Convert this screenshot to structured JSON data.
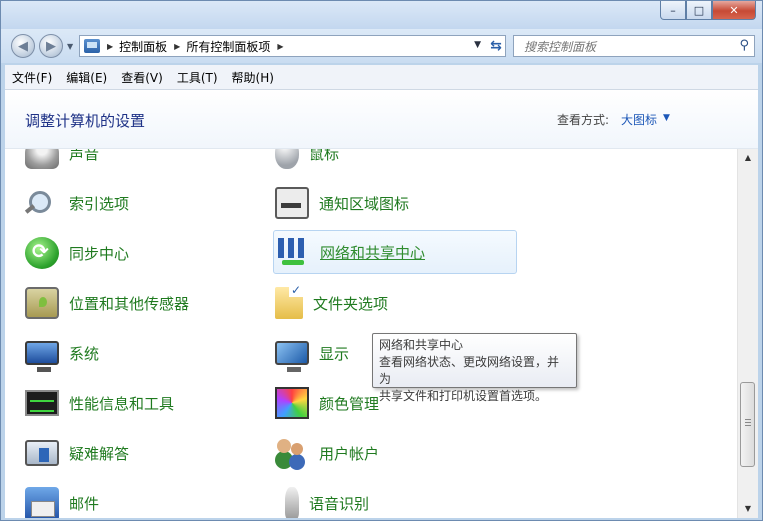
{
  "window": {
    "caption_buttons": {
      "minimize": "–",
      "maximize": "□",
      "close": "✕"
    }
  },
  "nav": {
    "back_icon": "back-arrow-icon",
    "forward_icon": "forward-arrow-icon",
    "breadcrumbs": [
      "控制面板",
      "所有控制面板项"
    ],
    "search_placeholder": "搜索控制面板"
  },
  "menu": [
    "文件(F)",
    "编辑(E)",
    "查看(V)",
    "工具(T)",
    "帮助(H)"
  ],
  "header": {
    "title": "调整计算机的设置",
    "view_label": "查看方式:",
    "view_value": "大图标"
  },
  "items": [
    {
      "label": "声音",
      "icon": "speaker-icon"
    },
    {
      "label": "鼠标",
      "icon": "mouse-icon"
    },
    {
      "label": "索引选项",
      "icon": "magnifier-icon"
    },
    {
      "label": "通知区域图标",
      "icon": "notification-tray-icon"
    },
    {
      "label": "同步中心",
      "icon": "sync-icon"
    },
    {
      "label": "网络和共享中心",
      "icon": "network-icon"
    },
    {
      "label": "位置和其他传感器",
      "icon": "location-sensor-icon"
    },
    {
      "label": "文件夹选项",
      "icon": "folder-options-icon"
    },
    {
      "label": "系统",
      "icon": "computer-icon"
    },
    {
      "label": "显示",
      "icon": "display-icon"
    },
    {
      "label": "性能信息和工具",
      "icon": "performance-meter-icon"
    },
    {
      "label": "颜色管理",
      "icon": "color-management-icon"
    },
    {
      "label": "疑难解答",
      "icon": "troubleshooting-icon"
    },
    {
      "label": "用户帐户",
      "icon": "user-accounts-icon"
    },
    {
      "label": "邮件",
      "icon": "mail-icon"
    },
    {
      "label": "语音识别",
      "icon": "microphone-icon"
    }
  ],
  "tooltip": {
    "title": "网络和共享中心",
    "line1": "查看网络状态、更改网络设置，并为",
    "line2": "共享文件和打印机设置首选项。"
  },
  "colors": {
    "item_label": "#1f7a1f",
    "title": "#1e3287",
    "link": "#1d58b8"
  }
}
